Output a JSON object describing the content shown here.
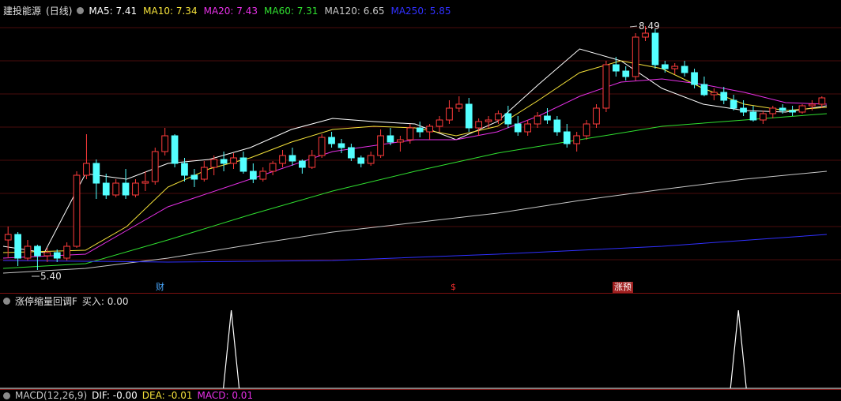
{
  "header": {
    "stock": "建投能源",
    "period": "(日线)",
    "ma": [
      {
        "label": "MA5: 7.41",
        "color": "#ffffff"
      },
      {
        "label": "MA10: 7.34",
        "color": "#f5e23a"
      },
      {
        "label": "MA20: 7.43",
        "color": "#e830e8"
      },
      {
        "label": "MA60: 7.31",
        "color": "#30e030"
      },
      {
        "label": "MA120: 6.65",
        "color": "#c8c8c8"
      },
      {
        "label": "MA250: 5.85",
        "color": "#3030ff"
      }
    ]
  },
  "annotations": {
    "high": "8.49",
    "low": "5.40"
  },
  "event_flags": [
    {
      "text": "财",
      "color": "#4aa8ff",
      "bg": "none"
    },
    {
      "text": "$",
      "color": "#ff3030",
      "bg": "none"
    },
    {
      "text": "涨预",
      "color": "#ffffff",
      "bg": "#a02020"
    }
  ],
  "indicator": {
    "name": "涨停缩量回调F",
    "buy_label": "买入: 0.00"
  },
  "macd": {
    "name": "MACD(12,26,9)",
    "dif": "DIF: -0.00",
    "dea": "DEA: -0.01",
    "macd": "MACD: 0.01"
  },
  "colors": {
    "up": "#ff3b3b",
    "down": "#54ffff",
    "bg": "#000000",
    "grid": "#4a0d0d"
  },
  "chart_data": {
    "type": "candlestick",
    "price_range": [
      5.3,
      8.6
    ],
    "candles": [
      [
        5.78,
        5.95,
        5.55,
        5.85
      ],
      [
        5.85,
        5.88,
        5.45,
        5.55
      ],
      [
        5.55,
        5.78,
        5.52,
        5.7
      ],
      [
        5.7,
        5.72,
        5.4,
        5.58
      ],
      [
        5.58,
        5.68,
        5.5,
        5.62
      ],
      [
        5.62,
        5.66,
        5.5,
        5.55
      ],
      [
        5.55,
        5.75,
        5.52,
        5.7
      ],
      [
        5.7,
        6.65,
        5.68,
        6.6
      ],
      [
        6.6,
        7.12,
        6.55,
        6.75
      ],
      [
        6.75,
        6.8,
        6.3,
        6.5
      ],
      [
        6.5,
        6.62,
        6.3,
        6.35
      ],
      [
        6.35,
        6.55,
        6.32,
        6.5
      ],
      [
        6.5,
        6.68,
        6.3,
        6.35
      ],
      [
        6.35,
        6.55,
        6.32,
        6.5
      ],
      [
        6.5,
        6.65,
        6.4,
        6.52
      ],
      [
        6.52,
        6.95,
        6.48,
        6.9
      ],
      [
        6.9,
        7.2,
        6.85,
        7.1
      ],
      [
        7.1,
        7.12,
        6.7,
        6.75
      ],
      [
        6.75,
        6.82,
        6.52,
        6.6
      ],
      [
        6.6,
        6.68,
        6.45,
        6.55
      ],
      [
        6.55,
        6.78,
        6.52,
        6.7
      ],
      [
        6.7,
        6.85,
        6.6,
        6.8
      ],
      [
        6.8,
        6.9,
        6.65,
        6.75
      ],
      [
        6.75,
        6.88,
        6.68,
        6.82
      ],
      [
        6.82,
        6.9,
        6.62,
        6.65
      ],
      [
        6.65,
        6.75,
        6.5,
        6.55
      ],
      [
        6.55,
        6.7,
        6.52,
        6.65
      ],
      [
        6.65,
        6.78,
        6.6,
        6.75
      ],
      [
        6.75,
        6.92,
        6.7,
        6.85
      ],
      [
        6.85,
        6.95,
        6.72,
        6.78
      ],
      [
        6.78,
        6.8,
        6.62,
        6.7
      ],
      [
        6.7,
        6.92,
        6.68,
        6.85
      ],
      [
        6.85,
        7.12,
        6.82,
        7.08
      ],
      [
        7.08,
        7.15,
        6.95,
        7.0
      ],
      [
        7.0,
        7.06,
        6.88,
        6.95
      ],
      [
        6.95,
        7.0,
        6.78,
        6.82
      ],
      [
        6.82,
        6.85,
        6.7,
        6.75
      ],
      [
        6.75,
        6.9,
        6.72,
        6.85
      ],
      [
        6.85,
        7.18,
        6.82,
        7.1
      ],
      [
        7.1,
        7.2,
        6.98,
        7.02
      ],
      [
        7.02,
        7.1,
        6.9,
        7.05
      ],
      [
        7.05,
        7.25,
        7.0,
        7.2
      ],
      [
        7.2,
        7.28,
        7.08,
        7.15
      ],
      [
        7.15,
        7.25,
        7.05,
        7.22
      ],
      [
        7.22,
        7.35,
        7.15,
        7.3
      ],
      [
        7.3,
        7.55,
        7.25,
        7.45
      ],
      [
        7.45,
        7.6,
        7.4,
        7.5
      ],
      [
        7.5,
        7.58,
        7.15,
        7.2
      ],
      [
        7.2,
        7.32,
        7.1,
        7.28
      ],
      [
        7.28,
        7.35,
        7.2,
        7.3
      ],
      [
        7.3,
        7.42,
        7.25,
        7.38
      ],
      [
        7.38,
        7.48,
        7.2,
        7.25
      ],
      [
        7.25,
        7.35,
        7.1,
        7.15
      ],
      [
        7.15,
        7.3,
        7.1,
        7.25
      ],
      [
        7.25,
        7.4,
        7.2,
        7.35
      ],
      [
        7.35,
        7.45,
        7.25,
        7.3
      ],
      [
        7.3,
        7.35,
        7.1,
        7.15
      ],
      [
        7.15,
        7.25,
        6.95,
        7.0
      ],
      [
        7.0,
        7.15,
        6.9,
        7.1
      ],
      [
        7.1,
        7.3,
        7.05,
        7.25
      ],
      [
        7.25,
        7.5,
        7.2,
        7.45
      ],
      [
        7.45,
        8.05,
        7.4,
        8.0
      ],
      [
        8.0,
        8.1,
        7.85,
        7.92
      ],
      [
        7.92,
        7.98,
        7.8,
        7.85
      ],
      [
        7.85,
        8.4,
        7.8,
        8.35
      ],
      [
        8.35,
        8.49,
        8.3,
        8.4
      ],
      [
        8.4,
        8.45,
        7.95,
        8.0
      ],
      [
        8.0,
        8.05,
        7.9,
        7.95
      ],
      [
        7.95,
        8.02,
        7.88,
        7.98
      ],
      [
        7.98,
        8.05,
        7.85,
        7.9
      ],
      [
        7.9,
        7.95,
        7.7,
        7.75
      ],
      [
        7.75,
        7.85,
        7.6,
        7.62
      ],
      [
        7.62,
        7.7,
        7.55,
        7.65
      ],
      [
        7.65,
        7.72,
        7.5,
        7.55
      ],
      [
        7.55,
        7.62,
        7.42,
        7.45
      ],
      [
        7.45,
        7.55,
        7.35,
        7.4
      ],
      [
        7.4,
        7.48,
        7.28,
        7.3
      ],
      [
        7.3,
        7.42,
        7.25,
        7.38
      ],
      [
        7.38,
        7.48,
        7.32,
        7.45
      ],
      [
        7.45,
        7.5,
        7.38,
        7.42
      ],
      [
        7.42,
        7.48,
        7.35,
        7.4
      ],
      [
        7.4,
        7.5,
        7.38,
        7.48
      ],
      [
        7.48,
        7.55,
        7.42,
        7.5
      ],
      [
        7.5,
        7.6,
        7.45,
        7.58
      ]
    ],
    "ma_lines": {
      "ma5": {
        "color": "#ffffff",
        "points": [
          [
            0,
            5.7
          ],
          [
            10,
            5.62
          ],
          [
            20,
            6.62
          ],
          [
            30,
            6.55
          ],
          [
            40,
            6.75
          ],
          [
            50,
            6.8
          ],
          [
            60,
            6.95
          ],
          [
            70,
            7.18
          ],
          [
            80,
            7.32
          ],
          [
            90,
            7.28
          ],
          [
            100,
            7.25
          ],
          [
            110,
            7.05
          ],
          [
            120,
            7.28
          ],
          [
            130,
            7.75
          ],
          [
            140,
            8.2
          ],
          [
            150,
            8.05
          ],
          [
            160,
            7.7
          ],
          [
            170,
            7.5
          ],
          [
            180,
            7.42
          ],
          [
            190,
            7.4
          ],
          [
            200,
            7.48
          ]
        ]
      },
      "ma10": {
        "color": "#f5e23a",
        "points": [
          [
            0,
            5.62
          ],
          [
            20,
            5.65
          ],
          [
            30,
            5.95
          ],
          [
            40,
            6.45
          ],
          [
            50,
            6.68
          ],
          [
            60,
            6.82
          ],
          [
            70,
            7.02
          ],
          [
            80,
            7.18
          ],
          [
            90,
            7.22
          ],
          [
            100,
            7.2
          ],
          [
            110,
            7.1
          ],
          [
            120,
            7.22
          ],
          [
            130,
            7.55
          ],
          [
            140,
            7.9
          ],
          [
            150,
            8.05
          ],
          [
            160,
            7.95
          ],
          [
            170,
            7.7
          ],
          [
            180,
            7.5
          ],
          [
            190,
            7.42
          ],
          [
            200,
            7.46
          ]
        ]
      },
      "ma20": {
        "color": "#e830e8",
        "points": [
          [
            0,
            5.55
          ],
          [
            20,
            5.6
          ],
          [
            30,
            5.9
          ],
          [
            40,
            6.2
          ],
          [
            60,
            6.55
          ],
          [
            80,
            6.9
          ],
          [
            100,
            7.05
          ],
          [
            110,
            7.05
          ],
          [
            120,
            7.15
          ],
          [
            130,
            7.35
          ],
          [
            140,
            7.6
          ],
          [
            150,
            7.78
          ],
          [
            160,
            7.82
          ],
          [
            170,
            7.75
          ],
          [
            180,
            7.65
          ],
          [
            190,
            7.52
          ],
          [
            200,
            7.5
          ]
        ]
      },
      "ma60": {
        "color": "#30e030",
        "points": [
          [
            0,
            5.42
          ],
          [
            20,
            5.48
          ],
          [
            40,
            5.78
          ],
          [
            60,
            6.1
          ],
          [
            80,
            6.4
          ],
          [
            100,
            6.65
          ],
          [
            120,
            6.88
          ],
          [
            140,
            7.05
          ],
          [
            160,
            7.22
          ],
          [
            180,
            7.3
          ],
          [
            200,
            7.38
          ]
        ]
      },
      "ma120": {
        "color": "#c8c8c8",
        "points": [
          [
            0,
            5.36
          ],
          [
            20,
            5.42
          ],
          [
            40,
            5.55
          ],
          [
            60,
            5.72
          ],
          [
            80,
            5.88
          ],
          [
            100,
            6.0
          ],
          [
            120,
            6.12
          ],
          [
            140,
            6.28
          ],
          [
            160,
            6.42
          ],
          [
            180,
            6.55
          ],
          [
            200,
            6.65
          ]
        ]
      },
      "ma250": {
        "color": "#3030ff",
        "points": [
          [
            0,
            5.52
          ],
          [
            40,
            5.5
          ],
          [
            80,
            5.52
          ],
          [
            120,
            5.6
          ],
          [
            160,
            5.7
          ],
          [
            200,
            5.85
          ]
        ]
      }
    },
    "signal_spikes": [
      [
        0.275,
        1
      ],
      [
        0.878,
        1
      ]
    ]
  }
}
